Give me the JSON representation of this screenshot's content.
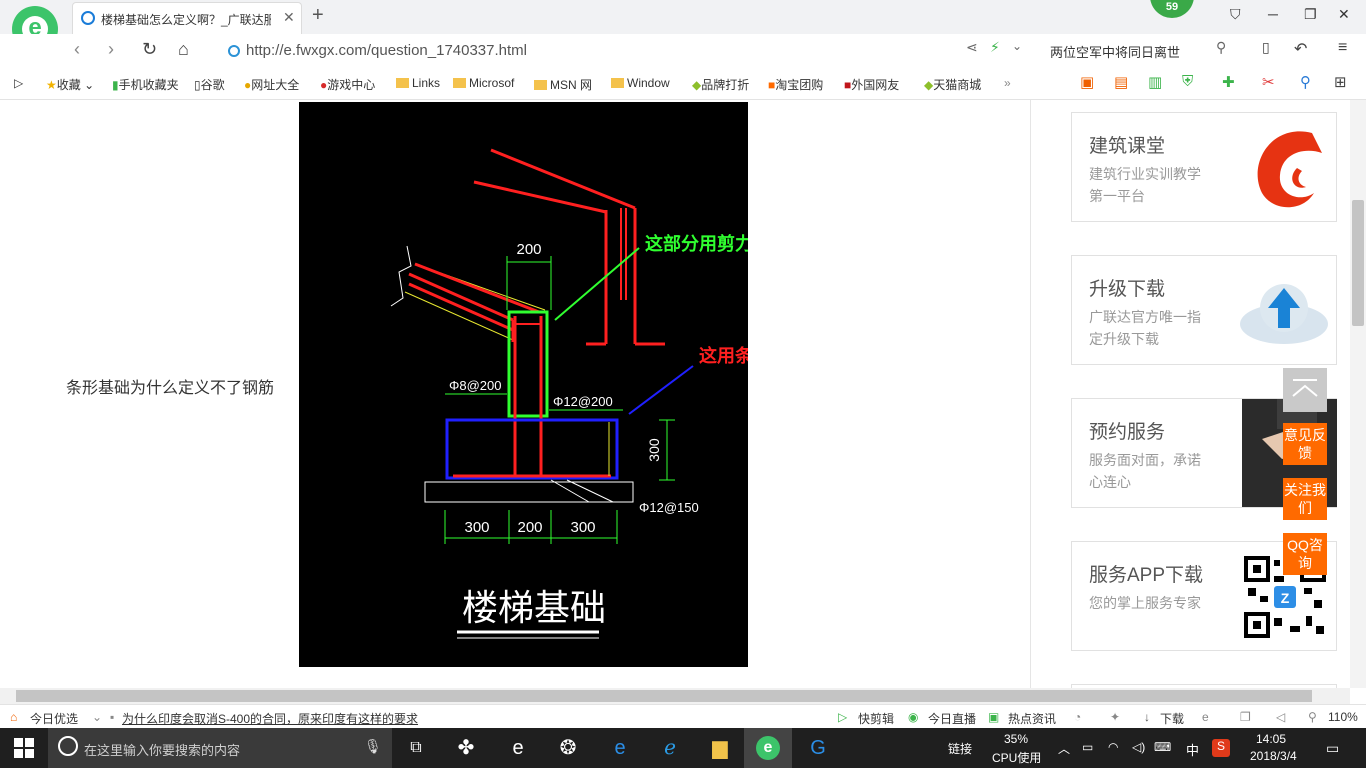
{
  "tab": {
    "title": "楼梯基础怎么定义啊？_广联达服"
  },
  "badge": "59",
  "address": {
    "url": "http://e.fwxgx.com/question_1740337.html"
  },
  "news": "两位空军中将同日离世",
  "bookmarks": [
    "收藏",
    "手机收藏夹",
    "谷歌",
    "网址大全",
    "游戏中心",
    "Links",
    "Microsof",
    "MSN 网",
    "Window",
    "品牌打折",
    "淘宝团购",
    "外国网友",
    "天猫商城"
  ],
  "question_text": "条形基础为什么定义不了钢筋",
  "cad": {
    "dim_top": "200",
    "ann_green": "这部分用剪力墙定义",
    "ann_red": "这用条形基础定义",
    "rebar_left": "Φ8@200",
    "rebar_right": "Φ12@200",
    "dim_height": "300",
    "rebar_bottom": "Φ12@150",
    "dim_b1": "300",
    "dim_b2": "200",
    "dim_b3": "300",
    "title": "楼梯基础"
  },
  "sidebar": [
    {
      "title": "建筑课堂",
      "sub": "建筑行业实训教学第一平台"
    },
    {
      "title": "升级下载",
      "sub": "广联达官方唯一指定升级下载"
    },
    {
      "title": "预约服务",
      "sub": "服务面对面，承诺心连心"
    },
    {
      "title": "服务APP下载",
      "sub": "您的掌上服务专家"
    }
  ],
  "float_buttons": [
    "意见反馈",
    "关注我们",
    "QQ咨询"
  ],
  "status": {
    "today": "今日优选",
    "headline": "为什么印度会取消S-400的合同，原来印度有这样的要求",
    "items": [
      "快剪辑",
      "今日直播",
      "热点资讯",
      "下载"
    ],
    "zoom": "110%"
  },
  "taskbar": {
    "search_placeholder": "在这里输入你要搜索的内容",
    "link": "链接",
    "cpu_pct": "35%",
    "cpu_label": "CPU使用",
    "ime": "中",
    "time": "14:05",
    "date": "2018/3/4"
  },
  "colors": {
    "accent": "#ff6a00",
    "brand_green": "#3cc46a",
    "taskbar": "#1f1f1f"
  }
}
